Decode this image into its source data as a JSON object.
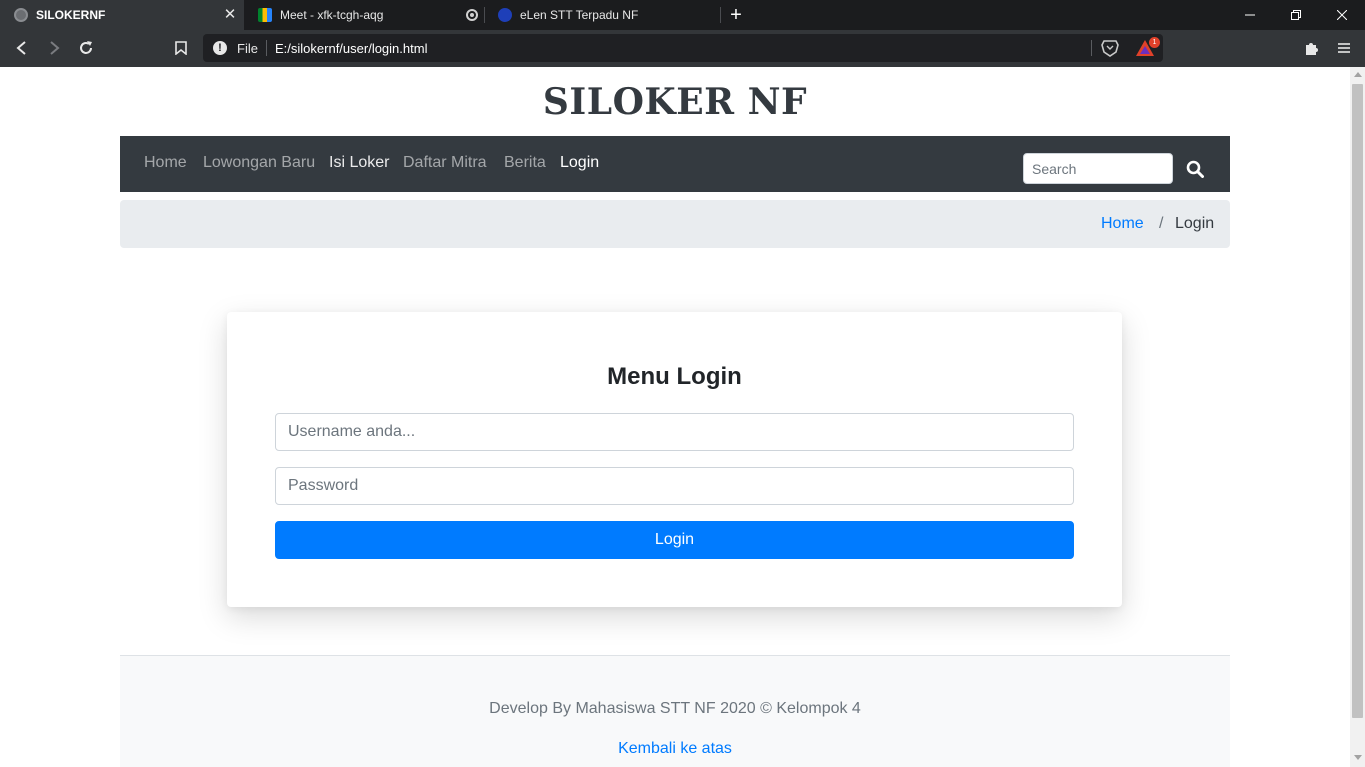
{
  "browser": {
    "tabs": [
      {
        "title": "SILOKERNF",
        "favicon": "globe-icon",
        "active": true
      },
      {
        "title": "Meet - xfk-tcgh-aqg",
        "favicon": "google-meet-icon",
        "active": false
      },
      {
        "title": "eLen STT Terpadu NF",
        "favicon": "elen-icon",
        "active": false
      }
    ],
    "omnibox": {
      "scheme_label": "File",
      "url": "E:/silokernf/user/login.html"
    },
    "rewards_badge": "1"
  },
  "page": {
    "brand": "SILOKER NF",
    "nav": {
      "items": [
        {
          "label": "Home"
        },
        {
          "label": "Lowongan Baru"
        },
        {
          "label": "Isi Loker"
        },
        {
          "label": "Daftar Mitra"
        },
        {
          "label": "Berita"
        },
        {
          "label": "Login"
        }
      ],
      "search_placeholder": "Search"
    },
    "breadcrumb": {
      "home": "Home",
      "separator": "/",
      "current": "Login"
    },
    "login_card": {
      "title": "Menu Login",
      "username_placeholder": "Username anda...",
      "password_placeholder": "Password",
      "submit_label": "Login"
    },
    "footer": {
      "text": "Develop By Mahasiswa STT NF 2020 © Kelompok 4",
      "back_to_top": "Kembali ke atas"
    }
  },
  "colors": {
    "navbar": "#343a40",
    "primary": "#007bff",
    "breadcrumb_bg": "#e9ecef",
    "footer_bg": "#f8f9fa"
  }
}
